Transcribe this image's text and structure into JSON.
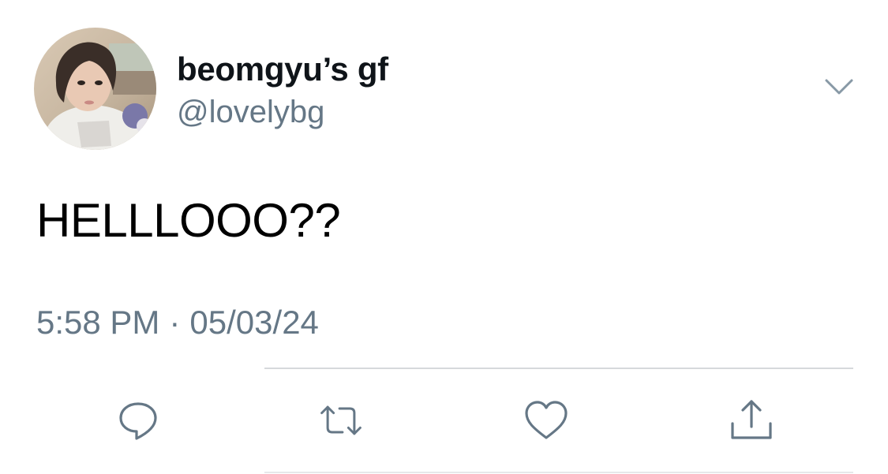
{
  "tweet": {
    "display_name": "beomgyu’s gf",
    "handle": "@lovelybg",
    "text": "HELLLOOO??",
    "time": "5:58 PM",
    "separator": "·",
    "date": "05/03/24"
  },
  "icons": {
    "avatar": "profile-photo",
    "more": "chevron-down-icon",
    "reply": "reply-icon",
    "retweet": "retweet-icon",
    "like": "heart-icon",
    "share": "share-icon"
  },
  "colors": {
    "text_primary": "#0f1419",
    "text_secondary": "#657786",
    "icon": "#657786",
    "divider": "#d6d9dc"
  }
}
